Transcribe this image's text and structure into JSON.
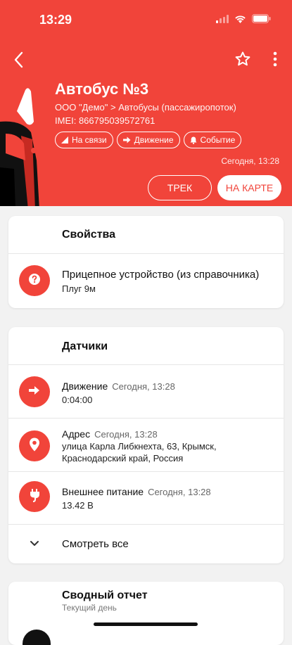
{
  "status_bar": {
    "time": "13:29"
  },
  "header": {
    "title": "Автобус №3",
    "path": "ООО \"Демо\" > Автобусы (пассажиропоток)",
    "imei": "IMEI: 866795039572761",
    "chips": [
      {
        "label": "На связи",
        "icon": "signal-icon"
      },
      {
        "label": "Движение",
        "icon": "arrow-right-icon"
      },
      {
        "label": "Событие",
        "icon": "bell-icon"
      }
    ],
    "updated": "Сегодня, 13:28",
    "track_button": "ТРЕК",
    "map_button": "НА КАРТЕ",
    "accent_color": "#f1443a"
  },
  "properties": {
    "title": "Свойства",
    "items": [
      {
        "label": "Прицепное устройство (из справочника)",
        "value": "Плуг 9м",
        "icon": "question-icon"
      }
    ]
  },
  "sensors": {
    "title": "Датчики",
    "items": [
      {
        "label": "Движение",
        "time": "Сегодня, 13:28",
        "value": "0:04:00",
        "icon": "arrow-right-icon"
      },
      {
        "label": "Адрес",
        "time": "Сегодня, 13:28",
        "value": "улица Карла Либкнехта, 63, Крымск, Краснодарский край, Россия",
        "icon": "location-pin-icon"
      },
      {
        "label": "Внешнее питание",
        "time": "Сегодня, 13:28",
        "value": "13.42 В",
        "icon": "power-plug-icon"
      }
    ],
    "show_all": "Смотреть все"
  },
  "summary": {
    "title": "Сводный отчет",
    "subtitle": "Текущий день"
  }
}
